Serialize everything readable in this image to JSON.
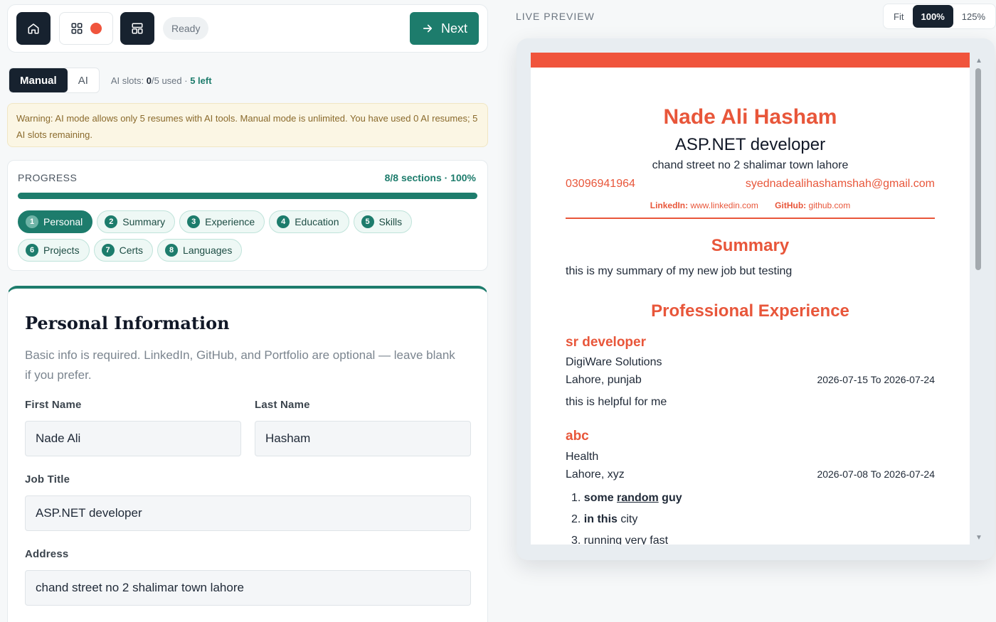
{
  "toolbar": {
    "status": "Ready",
    "next_label": "Next"
  },
  "mode": {
    "manual_label": "Manual",
    "ai_label": "AI",
    "slots_prefix": "AI slots:",
    "slots_used": "0",
    "slots_total_text": "/5 used ·",
    "slots_left": "5 left"
  },
  "warning": {
    "text": "Warning: AI mode allows only 5 resumes with AI tools. Manual mode is unlimited. You have used 0 AI resumes; 5 AI slots remaining."
  },
  "progress": {
    "label": "PROGRESS",
    "summary": "8/8 sections · 100%",
    "percent": 100,
    "sections": [
      {
        "num": "1",
        "label": "Personal",
        "active": true
      },
      {
        "num": "2",
        "label": "Summary"
      },
      {
        "num": "3",
        "label": "Experience"
      },
      {
        "num": "4",
        "label": "Education"
      },
      {
        "num": "5",
        "label": "Skills"
      },
      {
        "num": "6",
        "label": "Projects"
      },
      {
        "num": "7",
        "label": "Certs"
      },
      {
        "num": "8",
        "label": "Languages"
      }
    ]
  },
  "form": {
    "title": "Personal Information",
    "description": "Basic info is required. LinkedIn, GitHub, and Portfolio are optional — leave blank if you prefer.",
    "first_name_label": "First Name",
    "first_name_value": "Nade Ali",
    "last_name_label": "Last Name",
    "last_name_value": "Hasham",
    "job_title_label": "Job Title",
    "job_title_value": "ASP.NET developer",
    "address_label": "Address",
    "address_value": "chand street no 2 shalimar town lahore"
  },
  "preview": {
    "label": "LIVE PREVIEW",
    "zoom_options": [
      "Fit",
      "100%",
      "125%"
    ],
    "zoom_selected": "100%",
    "accent_color": "#f0543c",
    "resume": {
      "name": "Nade Ali Hasham",
      "title": "ASP.NET developer",
      "address": "chand street no 2 shalimar town lahore",
      "phone": "03096941964",
      "email": "syednadealihashamshah@gmail.com",
      "linkedin_label": "LinkedIn:",
      "linkedin_value": "www.linkedin.com",
      "github_label": "GitHub:",
      "github_value": "github.com",
      "summary_heading": "Summary",
      "summary_text": "this is my summary of my new job but testing",
      "experience_heading": "Professional Experience",
      "jobs": [
        {
          "role": "sr developer",
          "company": "DigiWare Solutions",
          "location": "Lahore, punjab",
          "dates": "2026-07-15 To 2026-07-24",
          "description": "this is helpful for me"
        },
        {
          "role": "abc",
          "company": "Health",
          "location": "Lahore, xyz",
          "dates": "2026-07-08 To 2026-07-24",
          "list": [
            {
              "num": "1.",
              "bold": "some",
              "underlined": "random",
              "bold_after": "guy"
            },
            {
              "num": "2.",
              "bold": "in this",
              "rest": "city"
            },
            {
              "num": "3.",
              "rest": "running very fast"
            }
          ]
        }
      ]
    }
  }
}
